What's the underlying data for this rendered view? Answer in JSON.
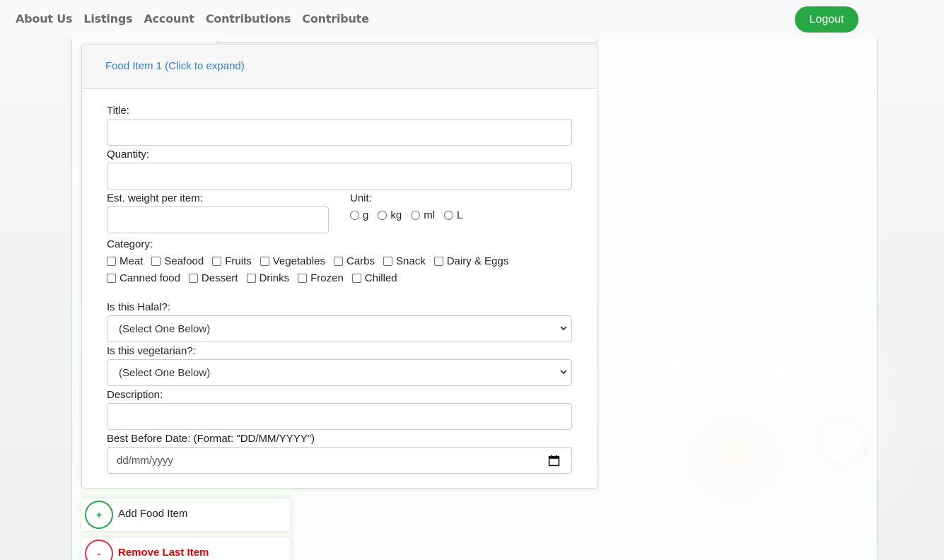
{
  "nav": {
    "links": [
      "About Us",
      "Listings",
      "Account",
      "Contributions",
      "Contribute"
    ],
    "logout_label": "Logout"
  },
  "form": {
    "item_header": "Food Item 1 (Click to expand)",
    "title_label": "Title:",
    "title_value": "",
    "quantity_label": "Quantity:",
    "quantity_value": "",
    "weight_label": "Est. weight per item:",
    "weight_value": "",
    "unit_label": "Unit:",
    "units": [
      "g",
      "kg",
      "ml",
      "L"
    ],
    "category_label": "Category:",
    "categories_row1": [
      "Meat",
      "Seafood",
      "Fruits",
      "Vegetables",
      "Carbs",
      "Snack",
      "Dairy & Eggs"
    ],
    "categories_row2": [
      "Canned food",
      "Dessert",
      "Drinks",
      "Frozen",
      "Chilled"
    ],
    "halal_label": "Is this Halal?:",
    "halal_selected": "(Select One Below)",
    "vegetarian_label": "Is this vegetarian?:",
    "vegetarian_selected": "(Select One Below)",
    "description_label": "Description:",
    "description_value": "",
    "best_before_label": "Best Before Date: (Format: \"DD/MM/YYYY\")",
    "best_before_placeholder": "dd/mm/yyyy"
  },
  "actions": {
    "add_symbol": "+",
    "add_label": "Add Food Item",
    "remove_symbol": "-",
    "remove_label": "Remove Last Item"
  },
  "colors": {
    "accent_green": "#28a745",
    "link_blue": "#2f7ed8",
    "danger_red": "#dc3545"
  }
}
